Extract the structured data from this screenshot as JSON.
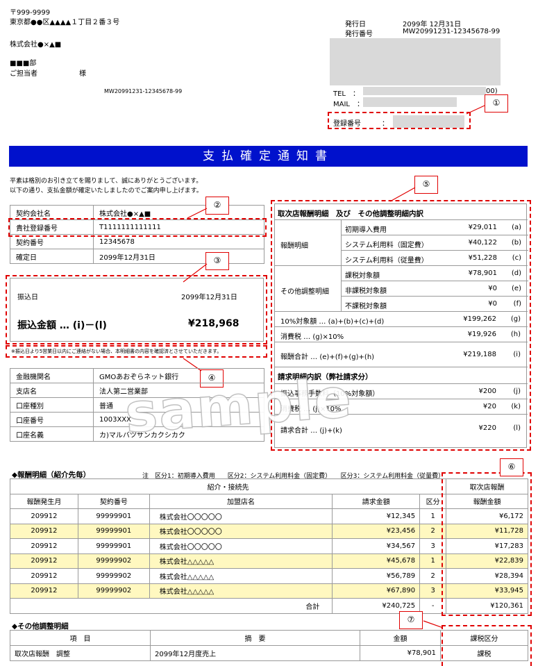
{
  "address": {
    "postal": "〒999-9999",
    "line1": "東京都●●区▲▲▲▲１丁目２番３号",
    "company": "株式会社●×▲■",
    "dept": "■■■部",
    "person": "ご担当者",
    "sama": "様",
    "doc_no": "MW20991231-12345678-99"
  },
  "issue": {
    "date_label": "発行日",
    "date": "2099年  12月31日",
    "no_label": "発行番号",
    "no": "MW20991231-12345678-99",
    "tel_label": "TEL　：",
    "tel_tail": "00)",
    "mail_label": "MAIL　：",
    "reg_label": "登録番号　　　："
  },
  "title": "支払確定通知書",
  "greeting": {
    "line1": "平素は格別のお引き立てを賜りまして、誠にありがとうございます。",
    "line2": "以下の通り、支払金額が確定いたしましたのでご案内申し上げます。"
  },
  "contract": [
    {
      "label": "契約会社名",
      "value": "株式会社●×▲■"
    },
    {
      "label": "貴社登録番号",
      "value": "T1111111111111"
    },
    {
      "label": "契約番号",
      "value": "12345678"
    },
    {
      "label": "確定日",
      "value": "2099年12月31日"
    }
  ],
  "payment": {
    "date_label": "振込日",
    "date": "2099年12月31日",
    "amount_label": "振込金額 … (i)－(l)",
    "amount": "¥218,968"
  },
  "note": "※振込日より5営業日以内にご連絡がない場合、本明細書の内容を確認済とさせていただきます。",
  "bank": [
    {
      "label": "金融機関名",
      "value": "GMOあおぞらネット銀行"
    },
    {
      "label": "支店名",
      "value": "法人第二営業部"
    },
    {
      "label": "口座種別",
      "value": "普通"
    },
    {
      "label": "口座番号",
      "value": "1003XXX"
    },
    {
      "label": "口座名義",
      "value": "カ)マルバツサンカクシカク"
    }
  ],
  "watermark": "sample",
  "markers": [
    "①",
    "②",
    "③",
    "④",
    "⑤",
    "⑥",
    "⑦"
  ],
  "breakdown": {
    "title": "取次店報酬明細　及び　その他調整明細内訳",
    "reward_label": "報酬明細",
    "reward": [
      {
        "label": "初期導入費用",
        "amount": "¥29,011",
        "code": "(a)"
      },
      {
        "label": "システム利用料（固定費）",
        "amount": "¥40,122",
        "code": "(b)"
      },
      {
        "label": "システム利用料（従量費）",
        "amount": "¥51,228",
        "code": "(c)"
      }
    ],
    "adjust_label": "その他調整明細",
    "adjust": [
      {
        "label": "課税対象額",
        "amount": "¥78,901",
        "code": "(d)"
      },
      {
        "label": "非課税対象額",
        "amount": "¥0",
        "code": "(e)"
      },
      {
        "label": "不課税対象額",
        "amount": "¥0",
        "code": "(f)"
      }
    ],
    "summary": [
      {
        "label": "10%対象額 … (a)+(b)+(c)+(d)",
        "amount": "¥199,262",
        "code": "(g)"
      },
      {
        "label": "消費税 … (g)×10%",
        "amount": "¥19,926",
        "code": "(h)"
      },
      {
        "label": "報酬合計 … (e)+(f)+(g)+(h)",
        "amount": "¥219,188",
        "code": "(i)"
      }
    ],
    "billing_title": "請求明細内訳（弊社請求分）",
    "billing": [
      {
        "label": "振込事務手数料（10%対象額）",
        "amount": "¥200",
        "code": "(j)"
      },
      {
        "label": "消費税 … (j)×10%",
        "amount": "¥20",
        "code": "(k)"
      },
      {
        "label": "請求合計 … (j)+(k)",
        "amount": "¥220",
        "code": "(l)"
      }
    ]
  },
  "report": {
    "title": "◆報酬明細（紹介先毎）",
    "legend": "注　区分1：初期導入費用　　区分2：システム利用料金（固定費）　　区分3：システム利用料金（従量費）",
    "group_header": "紹介・接続先",
    "agent_header": "取次店報酬",
    "columns": [
      "報酬発生月",
      "契約番号",
      "加盟店名",
      "請求金額",
      "区分",
      "報酬金額"
    ],
    "rows": [
      [
        "209912",
        "99999901",
        "株式会社〇〇〇〇〇",
        "¥12,345",
        "1",
        "¥6,172"
      ],
      [
        "209912",
        "99999901",
        "株式会社〇〇〇〇〇",
        "¥23,456",
        "2",
        "¥11,728"
      ],
      [
        "209912",
        "99999901",
        "株式会社〇〇〇〇〇",
        "¥34,567",
        "3",
        "¥17,283"
      ],
      [
        "209912",
        "99999902",
        "株式会社△△△△△",
        "¥45,678",
        "1",
        "¥22,839"
      ],
      [
        "209912",
        "99999902",
        "株式会社△△△△△",
        "¥56,789",
        "2",
        "¥28,394"
      ],
      [
        "209912",
        "99999902",
        "株式会社△△△△△",
        "¥67,890",
        "3",
        "¥33,945"
      ]
    ],
    "total_label": "合計",
    "total_amount": "¥240,725",
    "total_dash": "-",
    "total_reward": "¥120,361"
  },
  "other": {
    "title": "◆その他調整明細",
    "columns": [
      "項　目",
      "摘　要",
      "金額",
      "課税区分"
    ],
    "row": [
      "取次店報酬　調整",
      "2099年12月度売上",
      "¥78,901",
      "課税"
    ]
  }
}
